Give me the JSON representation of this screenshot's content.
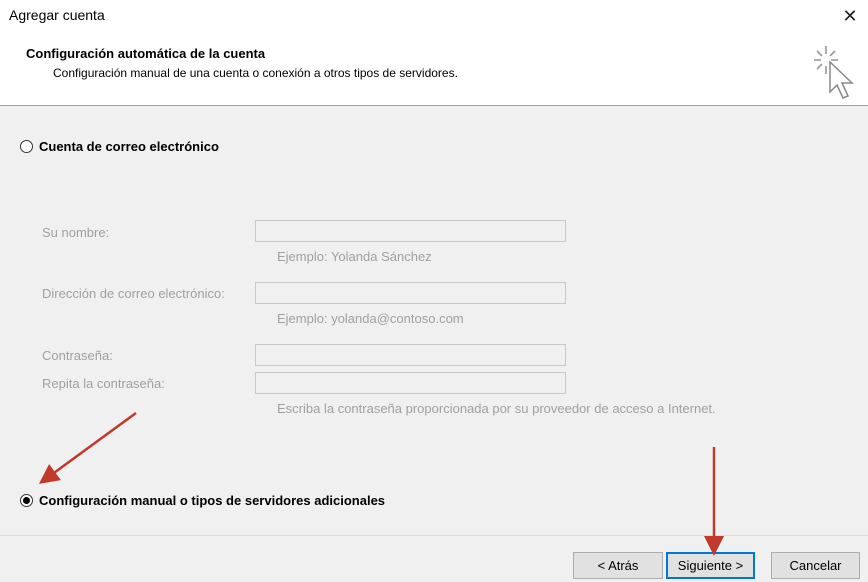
{
  "window": {
    "title": "Agregar cuenta",
    "close_glyph": "✕"
  },
  "header": {
    "title": "Configuración automática de la cuenta",
    "subtitle": "Configuración manual de una cuenta o conexión a otros tipos de servidores.",
    "icon": "cursor-sparkle-icon"
  },
  "options": {
    "email_account_label": "Cuenta de correo electrónico",
    "email_account_selected": false,
    "manual_label": "Configuración manual o tipos de servidores adicionales",
    "manual_selected": true
  },
  "form": {
    "name_label": "Su nombre:",
    "name_hint": "Ejemplo: Yolanda Sánchez",
    "email_label": "Dirección de correo electrónico:",
    "email_hint": "Ejemplo: yolanda@contoso.com",
    "password_label": "Contraseña:",
    "repeat_password_label": "Repita la contraseña:",
    "password_hint": "Escriba la contraseña proporcionada por su proveedor de acceso a Internet."
  },
  "buttons": {
    "back": "< Atrás",
    "next": "Siguiente >",
    "cancel": "Cancelar"
  },
  "colors": {
    "annotation_arrow": "#c0392b",
    "default_button_border": "#0078d7",
    "disabled_text": "#a0a0a0"
  }
}
